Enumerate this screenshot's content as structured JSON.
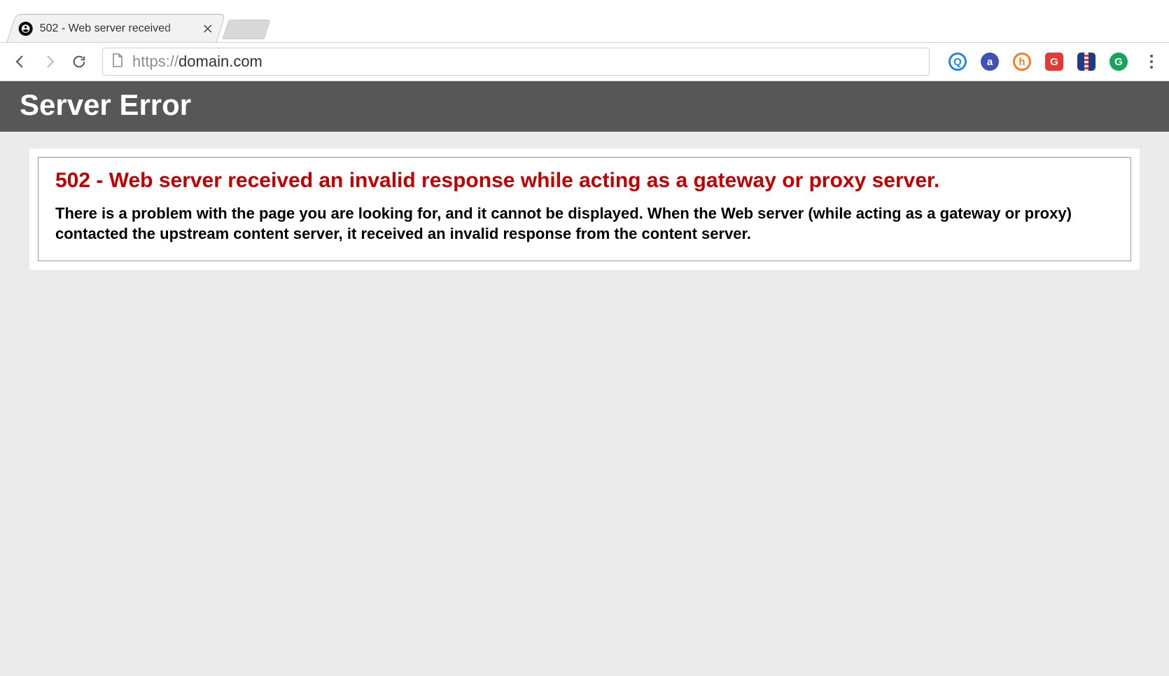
{
  "browser": {
    "tab_title": "502 - Web server received",
    "url_scheme": "https://",
    "url_rest": "domain.com"
  },
  "extensions": {
    "q_label": "Q",
    "a_label": "a",
    "h_label": "h",
    "g1_label": "G",
    "g2_label": "G"
  },
  "page": {
    "banner": "Server Error",
    "error_title": "502 - Web server received an invalid response while acting as a gateway or proxy server.",
    "error_desc": "There is a problem with the page you are looking for, and it cannot be displayed. When the Web server (while acting as a gateway or proxy) contacted the upstream content server, it received an invalid response from the content server."
  }
}
